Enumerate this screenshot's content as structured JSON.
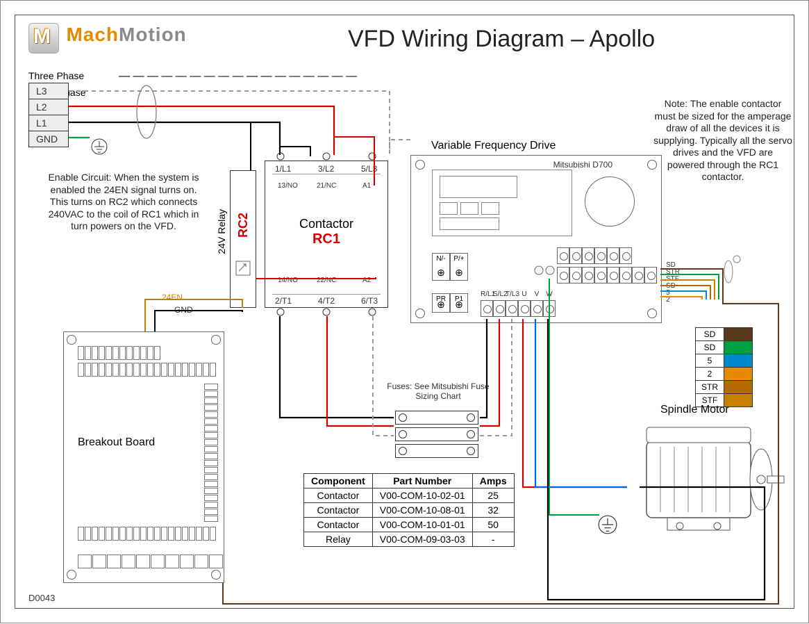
{
  "doc_id": "D0043",
  "title": "VFD Wiring Diagram – Apollo",
  "logo": {
    "brand1": "Mach",
    "brand2": "Motion"
  },
  "power_input": {
    "three_phase_label": "Three Phase",
    "single_phase_label": "Single Phase",
    "terminals": [
      "L3",
      "L2",
      "L1",
      "GND"
    ]
  },
  "enable_note": "Enable Circuit: When the system is enabled the 24EN signal turns on. This turns on RC2 which connects 240VAC to the coil of RC1 which in turn powers on the VFD.",
  "sizing_note": "Note: The enable contactor must be sized for the amperage draw of all the devices it is supplying. Typically all the servo drives and the VFD are powered through the RC1 contactor.",
  "relay": {
    "label": "24V Relay",
    "id": "RC2",
    "wires": {
      "en": "24EN",
      "gnd": "GND"
    }
  },
  "contactor": {
    "title": "Contactor",
    "id": "RC1",
    "top_terms": [
      "1/L1",
      "3/L2",
      "5/L3"
    ],
    "aux_top": [
      "13/NO",
      "21/NC",
      "A1"
    ],
    "aux_bot": [
      "14/NO",
      "22/NC",
      "A2"
    ],
    "bot_terms": [
      "2/T1",
      "4/T2",
      "6/T3"
    ]
  },
  "vfd": {
    "heading": "Variable Frequency Drive",
    "model": "Mitsubishi D700",
    "dc_terms": [
      "N/-",
      "P/+"
    ],
    "aux_terms": [
      "PR",
      "P1"
    ],
    "power_terms": [
      "R/L1",
      "S/L2",
      "T/L3",
      "U",
      "V",
      "W"
    ],
    "signal_labels": [
      "SD",
      "STR",
      "STF",
      "SD",
      "5",
      "2"
    ]
  },
  "fuses": {
    "caption": "Fuses: See Mitsubishi Fuse Sizing Chart"
  },
  "parts_table": {
    "headers": [
      "Component",
      "Part Number",
      "Amps"
    ],
    "rows": [
      [
        "Contactor",
        "V00-COM-10-02-01",
        "25"
      ],
      [
        "Contactor",
        "V00-COM-10-08-01",
        "32"
      ],
      [
        "Contactor",
        "V00-COM-10-01-01",
        "50"
      ],
      [
        "Relay",
        "V00-COM-09-03-03",
        "-"
      ]
    ]
  },
  "signal_legend": {
    "rows": [
      {
        "name": "SD",
        "color": "#5a3a1a"
      },
      {
        "name": "SD",
        "color": "#00a040"
      },
      {
        "name": "5",
        "color": "#0088cc"
      },
      {
        "name": "2",
        "color": "#e68a00"
      },
      {
        "name": "STR",
        "color": "#b06a00"
      },
      {
        "name": "STF",
        "color": "#c77f00"
      }
    ]
  },
  "breakout": {
    "title": "Breakout Board"
  },
  "motor": {
    "title": "Spindle Motor"
  },
  "wire_colors": {
    "L1": "#000000",
    "L2": "#d40000",
    "L3_dashed": "#999999",
    "GND": "#00a040",
    "U": "#d40000",
    "V": "#0066dd",
    "W": "#000000",
    "shield": "#808080"
  }
}
